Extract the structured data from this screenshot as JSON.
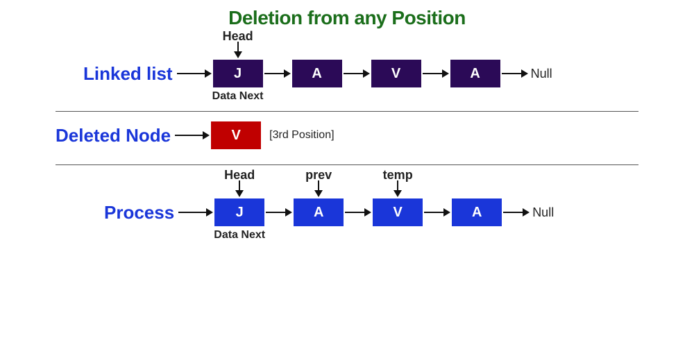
{
  "title": "Deletion from any Position",
  "section1": {
    "label": "Linked list",
    "headLabel": "Head",
    "dataNextLabel": "Data Next",
    "nodes": [
      "J",
      "A",
      "V",
      "A"
    ],
    "terminal": "Null"
  },
  "section2": {
    "label": "Deleted Node",
    "node": "V",
    "note": "[3rd Position]"
  },
  "section3": {
    "label": "Process",
    "labels": {
      "head": "Head",
      "prev": "prev",
      "temp": "temp"
    },
    "dataNextLabel": "Data Next",
    "nodes": [
      "J",
      "A",
      "V",
      "A"
    ],
    "terminal": "Null"
  },
  "colors": {
    "titleGreen": "#1b6e1b",
    "labelBlue": "#1a36d9",
    "nodePurple": "#2b0a57",
    "nodeBlue": "#1a36d9",
    "nodeRed": "#c00000"
  }
}
